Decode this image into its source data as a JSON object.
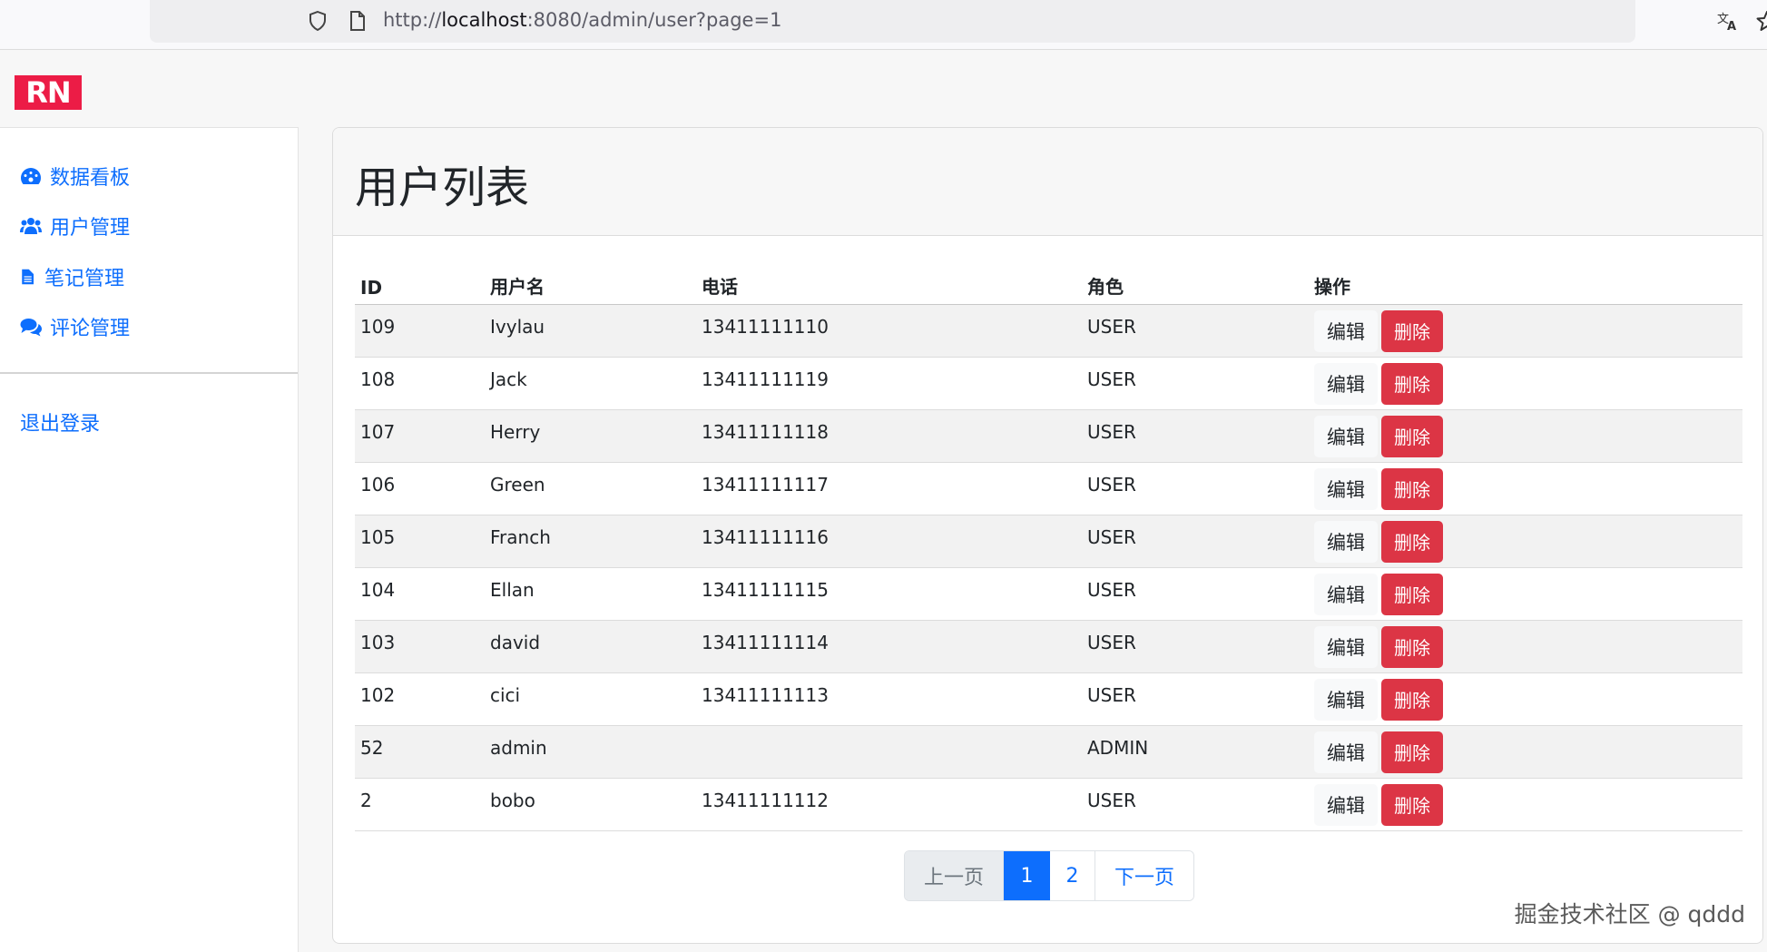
{
  "browser": {
    "url_prefix": "http://",
    "url_host": "localhost",
    "url_rest": ":8080/admin/user?page=1"
  },
  "logo": {
    "text": "RN",
    "color": "#ec1c46"
  },
  "sidebar": {
    "items": [
      {
        "label": "数据看板",
        "icon": "dashboard-icon"
      },
      {
        "label": "用户管理",
        "icon": "users-icon"
      },
      {
        "label": "笔记管理",
        "icon": "file-icon"
      },
      {
        "label": "评论管理",
        "icon": "comments-icon"
      }
    ],
    "logout": "退出登录"
  },
  "main": {
    "title": "用户列表",
    "columns": [
      "ID",
      "用户名",
      "电话",
      "角色",
      "操作"
    ],
    "edit_label": "编辑",
    "delete_label": "删除",
    "rows": [
      {
        "id": "109",
        "username": "Ivylau",
        "phone": "13411111110",
        "role": "USER"
      },
      {
        "id": "108",
        "username": "Jack",
        "phone": "13411111119",
        "role": "USER"
      },
      {
        "id": "107",
        "username": "Herry",
        "phone": "13411111118",
        "role": "USER"
      },
      {
        "id": "106",
        "username": "Green",
        "phone": "13411111117",
        "role": "USER"
      },
      {
        "id": "105",
        "username": "Franch",
        "phone": "13411111116",
        "role": "USER"
      },
      {
        "id": "104",
        "username": "Ellan",
        "phone": "13411111115",
        "role": "USER"
      },
      {
        "id": "103",
        "username": "david",
        "phone": "13411111114",
        "role": "USER"
      },
      {
        "id": "102",
        "username": "cici",
        "phone": "13411111113",
        "role": "USER"
      },
      {
        "id": "52",
        "username": "admin",
        "phone": "",
        "role": "ADMIN"
      },
      {
        "id": "2",
        "username": "bobo",
        "phone": "13411111112",
        "role": "USER"
      }
    ]
  },
  "pagination": {
    "prev": "上一页",
    "pages": [
      "1",
      "2"
    ],
    "current": "1",
    "next": "下一页"
  },
  "watermark": "掘金技术社区 @ qddd",
  "colors": {
    "primary": "#0d6efd",
    "danger": "#dc3545"
  }
}
